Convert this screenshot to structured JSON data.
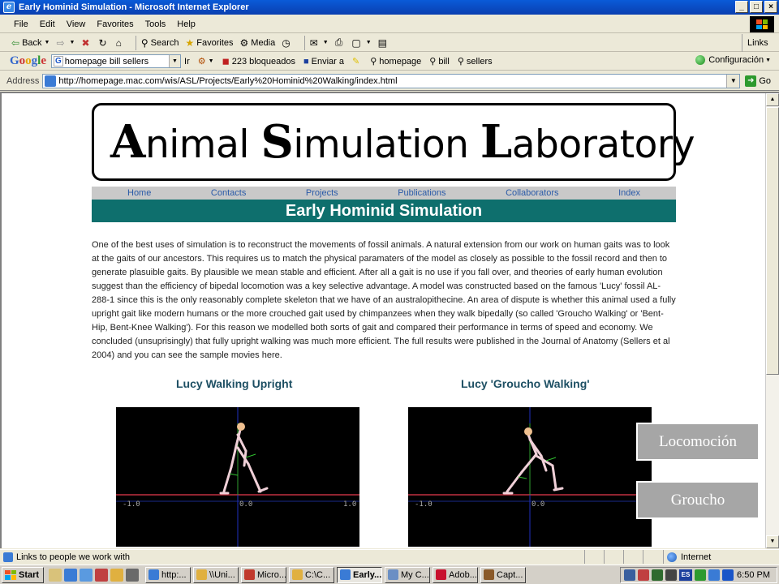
{
  "window": {
    "title": "Early Hominid Simulation - Microsoft Internet Explorer",
    "controls": [
      "_",
      "□",
      "×"
    ]
  },
  "menu": [
    "File",
    "Edit",
    "View",
    "Favorites",
    "Tools",
    "Help"
  ],
  "toolbar": {
    "back": "Back",
    "search": "Search",
    "favorites": "Favorites",
    "media": "Media",
    "links": "Links"
  },
  "google_bar": {
    "logo": "Google",
    "search_value": "homepage bill sellers",
    "go_label": "Ir",
    "blocked": "223 bloqueados",
    "send": "Enviar a",
    "terms": [
      "homepage",
      "bill",
      "sellers"
    ],
    "config": "Configuración"
  },
  "address_bar": {
    "label": "Address",
    "url": "http://homepage.mac.com/wis/ASL/Projects/Early%20Hominid%20Walking/index.html",
    "go": "Go"
  },
  "page": {
    "logo": {
      "a_cap": "A",
      "a_rest": "nimal ",
      "s_cap": "S",
      "s_rest": "imulation ",
      "l_cap": "L",
      "l_rest": "aboratory"
    },
    "nav": [
      "Home",
      "Contacts",
      "Projects",
      "Publications",
      "Collaborators",
      "Index"
    ],
    "banner": "Early Hominid Simulation",
    "body": "One of the best uses of simulation is to reconstruct the movements of fossil animals. A natural extension from our work on human gaits was to look at the gaits of our ancestors. This requires us to match the physical paramaters of the model as closely as possible to the fossil record and then to generate plasuible gaits. By plausible we mean stable and efficient. After all a gait is no use if you fall over, and theories of early human evolution suggest than the efficiency of bipedal locomotion was a key selective advantage. A model was constructed based on the famous 'Lucy' fossil AL-288-1 since this is the only reasonably complete skeleton that we have of an australopithecine. An area of dispute is whether this animal used a fully upright gait like modern humans or the more crouched gait used by chimpanzees when they walk bipedally (so called 'Groucho Walking' or 'Bent-Hip, Bent-Knee Walking'). For this reason we modelled both sorts of gait and compared their performance in terms of speed and economy. We concluded (unsuprisingly) that fully upright walking was much more efficient. The full results were published in the Journal of Anatomy (Sellers et al 2004) and you can see the sample movies here.",
    "caption_left": "Lucy Walking Upright",
    "caption_right": "Lucy 'Groucho Walking'",
    "axis_labels": [
      "-1.0",
      "0.0",
      "1.0"
    ]
  },
  "overlay_buttons": [
    "Locomoción",
    "Groucho"
  ],
  "status": {
    "text": "Links to people we work with",
    "zone": "Internet"
  },
  "taskbar": {
    "start": "Start",
    "tasks": [
      "http:...",
      "\\\\Uni...",
      "Micro...",
      "C:\\C...",
      "Early...",
      "My C...",
      "Adob...",
      "Capt..."
    ],
    "active_index": 4,
    "lang": "ES",
    "clock": "6:50 PM"
  }
}
